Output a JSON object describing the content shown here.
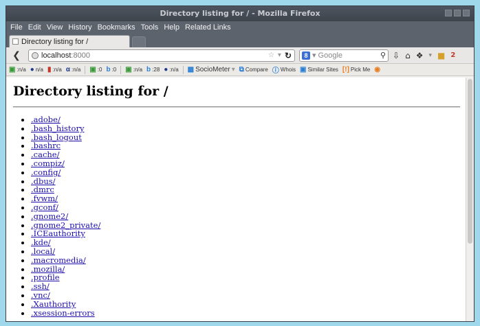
{
  "window": {
    "title": "Directory listing for / - Mozilla Firefox"
  },
  "menu": [
    "File",
    "Edit",
    "View",
    "History",
    "Bookmarks",
    "Tools",
    "Help",
    "Related Links"
  ],
  "tab": {
    "label": "Directory listing for /"
  },
  "navbar": {
    "url_host": "localhost",
    "url_port": ":8000",
    "search_placeholder": "Google",
    "badge": "2"
  },
  "seobar": {
    "items": [
      {
        "value": ":n/a"
      },
      {
        "value": "n/a"
      },
      {
        "value": ":n/a"
      },
      {
        "value": ":n/a"
      },
      {
        "value": ":0"
      },
      {
        "value": ":0"
      },
      {
        "value": ":n/a"
      },
      {
        "value": ":28"
      },
      {
        "value": ":n/a"
      }
    ],
    "sociometer": "SocioMeter",
    "compare": "Compare",
    "whois": "Whois",
    "similar": "Similar Sites",
    "pickme": "Pick Me"
  },
  "page": {
    "heading": "Directory listing for /",
    "entries": [
      ".adobe/",
      ".bash_history",
      ".bash_logout",
      ".bashrc",
      ".cache/",
      ".compiz/",
      ".config/",
      ".dbus/",
      ".dmrc",
      ".fvwm/",
      ".gconf/",
      ".gnome2/",
      ".gnome2_private/",
      ".ICEauthority",
      ".kde/",
      ".local/",
      ".macromedia/",
      ".mozilla/",
      ".profile",
      ".ssh/",
      ".vnc/",
      ".Xauthority",
      ".xsession-errors"
    ]
  }
}
